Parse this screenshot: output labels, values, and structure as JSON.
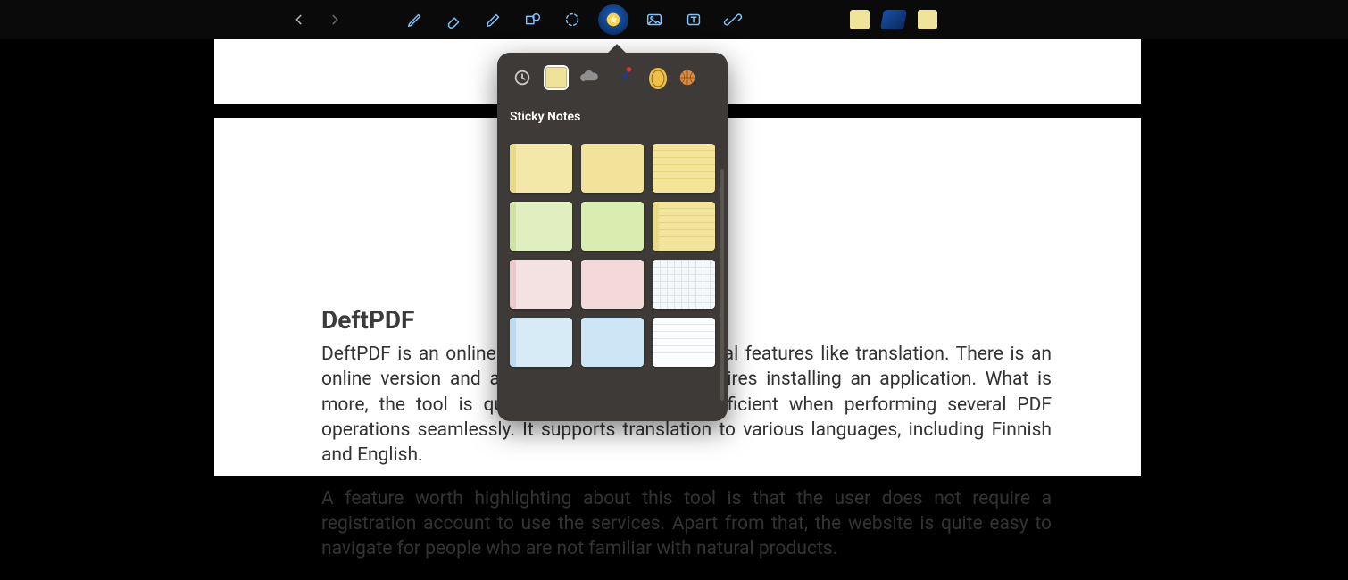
{
  "toolbar": {
    "undo": "undo",
    "redo": "redo",
    "tools": [
      "pen",
      "eraser",
      "highlighter",
      "shape",
      "lasso",
      "stickers",
      "image",
      "text",
      "link"
    ],
    "active_tool": "stickers"
  },
  "quick_tools": {
    "note": "yellow-note",
    "eraser": "eraser",
    "note2": "yellow-note"
  },
  "popover": {
    "title": "Sticky Notes",
    "categories": [
      "recent",
      "notes",
      "cloud",
      "pen",
      "stamp",
      "ball"
    ],
    "selected_category": "notes",
    "notes": [
      "yellow-1",
      "yellow-2",
      "yellow-lined",
      "green-1",
      "green-2",
      "yellow-lined2",
      "pink-1",
      "pink-2",
      "grid-blue",
      "blue-1",
      "blue-2",
      "white-lined"
    ]
  },
  "document": {
    "title": "DeftPDF",
    "p1": "DeftPDF is an online PDF editor tool with several features like translation. There is an online version and an offline version that requires installing an application. What is more, the tool is quite simple to use and efficient when performing several PDF operations seamlessly. It supports translation to various languages, including Finnish and English.",
    "p2": "A feature worth highlighting about this tool is that the user does not require a registration account to use the services. Apart from that, the website is quite easy to navigate for people who are not familiar with natural products."
  }
}
